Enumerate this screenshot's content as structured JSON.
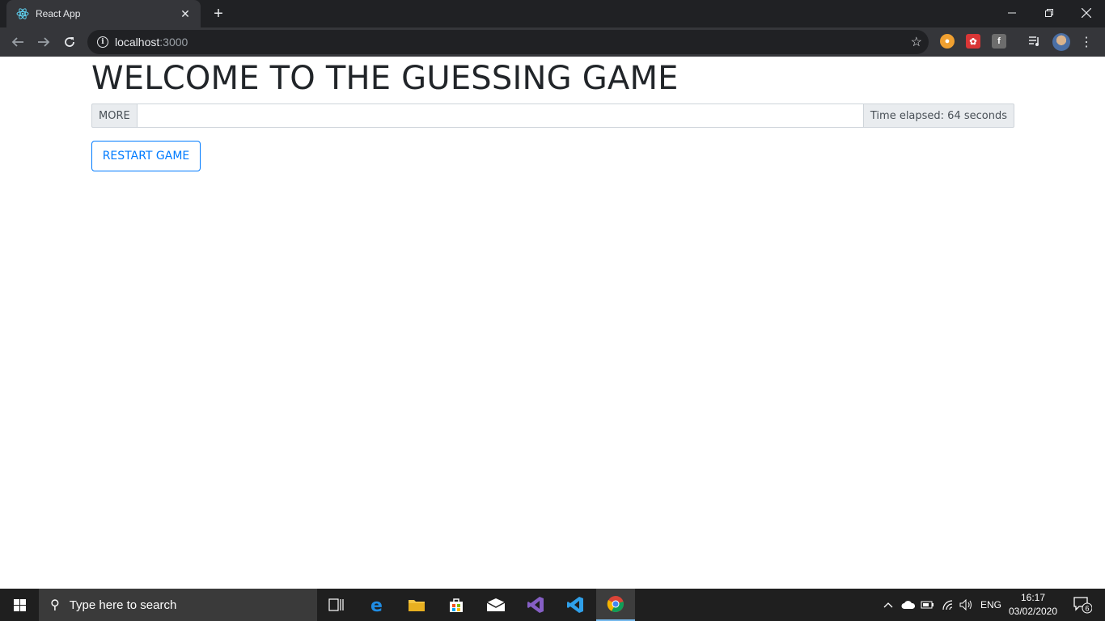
{
  "browser": {
    "tab_title": "React App",
    "url_host": "localhost",
    "url_port": ":3000"
  },
  "page": {
    "heading": "WELCOME TO THE GUESSING GAME",
    "more_label": "MORE",
    "guess_value": "",
    "time_elapsed": "Time elapsed: 64 seconds",
    "restart_label": "RESTART GAME"
  },
  "taskbar": {
    "search_placeholder": "Type here to search",
    "language": "ENG",
    "time": "16:17",
    "date": "03/02/2020",
    "notification_count": "6"
  },
  "colors": {
    "primary": "#007bff",
    "addon_bg": "#e9ecef",
    "chrome_dark": "#202124"
  }
}
